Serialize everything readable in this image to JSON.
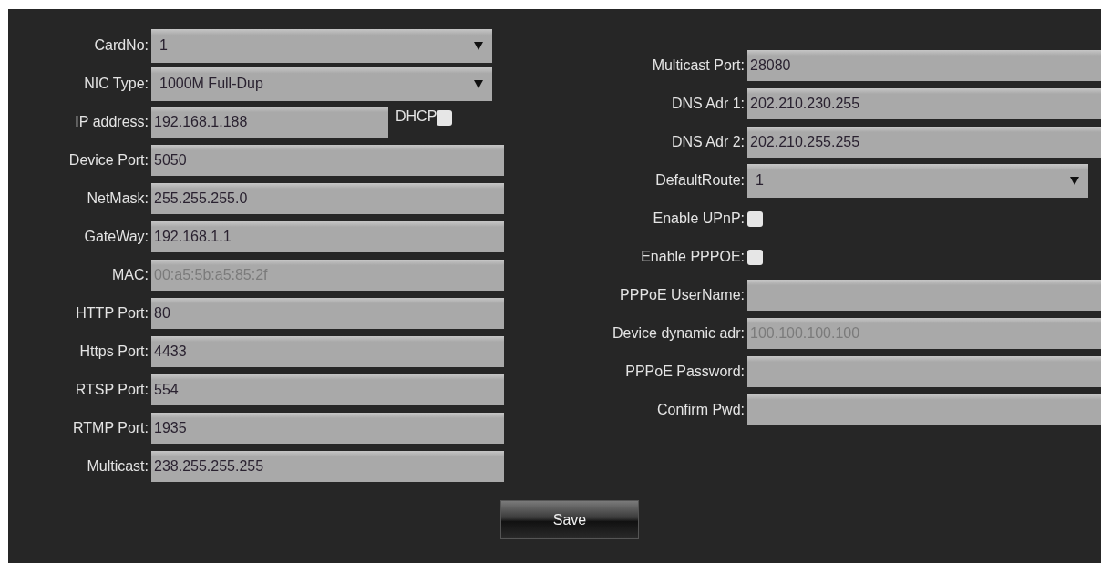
{
  "left": [
    {
      "kind": "select",
      "label": "CardNo:",
      "value": "1"
    },
    {
      "kind": "select",
      "label": "NIC Type:",
      "value": "1000M Full-Dup"
    },
    {
      "kind": "text_check",
      "label": "IP address:",
      "value": "192.168.1.188",
      "disabled": false,
      "check_label": "DHCP",
      "checked": false
    },
    {
      "kind": "text",
      "label": "Device Port:",
      "value": "5050",
      "disabled": false
    },
    {
      "kind": "text",
      "label": "NetMask:",
      "value": "255.255.255.0",
      "disabled": false
    },
    {
      "kind": "text",
      "label": "GateWay:",
      "value": "192.168.1.1",
      "disabled": false
    },
    {
      "kind": "text",
      "label": "MAC:",
      "value": "00:a5:5b:a5:85:2f",
      "disabled": true
    },
    {
      "kind": "text",
      "label": "HTTP Port:",
      "value": "80",
      "disabled": false
    },
    {
      "kind": "text",
      "label": "Https Port:",
      "value": "4433",
      "disabled": false
    },
    {
      "kind": "text",
      "label": "RTSP Port:",
      "value": "554",
      "disabled": false
    },
    {
      "kind": "text",
      "label": "RTMP Port:",
      "value": "1935",
      "disabled": false
    },
    {
      "kind": "text",
      "label": "Multicast:",
      "value": "238.255.255.255",
      "disabled": false
    }
  ],
  "right": [
    {
      "kind": "text",
      "label": "Multicast Port:",
      "value": "28080",
      "disabled": false
    },
    {
      "kind": "text",
      "label": "DNS Adr 1:",
      "value": "202.210.230.255",
      "disabled": false
    },
    {
      "kind": "text",
      "label": "DNS Adr 2:",
      "value": "202.210.255.255",
      "disabled": false
    },
    {
      "kind": "select",
      "label": "DefaultRoute:",
      "value": "1"
    },
    {
      "kind": "checkbox",
      "label": "Enable UPnP:",
      "checked": false
    },
    {
      "kind": "checkbox",
      "label": "Enable PPPOE:",
      "checked": false
    },
    {
      "kind": "text",
      "label": "PPPoE UserName:"
    },
    {
      "kind": "text",
      "label": "Device dynamic adr:",
      "value": "100.100.100.100",
      "disabled": true
    },
    {
      "kind": "text",
      "label": "PPPoE Password:"
    },
    {
      "kind": "text",
      "label": "Confirm Pwd:"
    }
  ],
  "save_button": "Save"
}
